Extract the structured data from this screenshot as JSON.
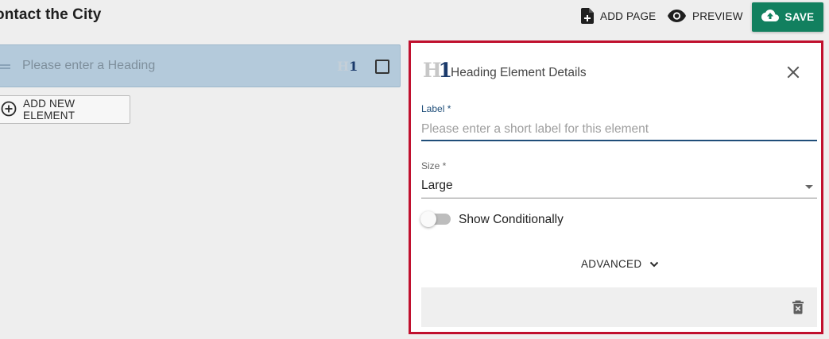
{
  "page": {
    "title": "ontact the City"
  },
  "toolbar": {
    "add_page_label": "ADD PAGE",
    "add_page_icon": "file-plus-icon",
    "preview_label": "PREVIEW",
    "preview_icon": "eye-icon",
    "save_label": "SAVE",
    "save_icon": "cloud-upload-icon",
    "save_color": "#12805f"
  },
  "builder": {
    "heading_row": {
      "placeholder": "Please enter a Heading",
      "badge_h": "H",
      "badge_one": "1",
      "checked": false
    },
    "add_element_label": "ADD NEW ELEMENT"
  },
  "details_panel": {
    "border_color": "#c0102e",
    "icon_h": "H",
    "icon_one": "1",
    "title": "Heading Element Details",
    "label_field": {
      "label": "Label *",
      "value": "",
      "placeholder": "Please enter a short label for this element"
    },
    "size_field": {
      "label": "Size *",
      "value": "Large"
    },
    "show_conditionally": {
      "label": "Show Conditionally",
      "enabled": false
    },
    "advanced_label": "ADVANCED"
  }
}
